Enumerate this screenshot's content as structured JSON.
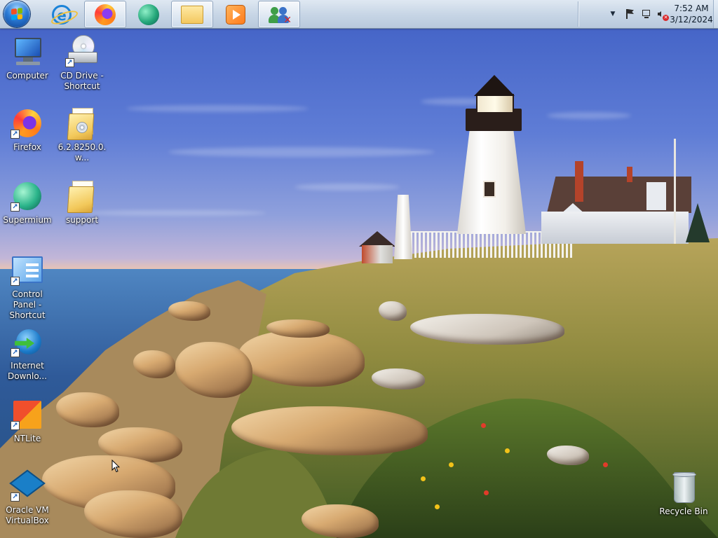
{
  "taskbar": {
    "start_button": {
      "icon": "windows-logo-icon",
      "label": "Start"
    },
    "pinned": [
      {
        "name": "internet-explorer",
        "icon": "internet-explorer-icon",
        "active": false
      },
      {
        "name": "firefox",
        "icon": "firefox-icon",
        "active": true
      },
      {
        "name": "supermium",
        "icon": "supermium-icon",
        "active": false
      },
      {
        "name": "file-explorer",
        "icon": "folder-icon",
        "active": true
      },
      {
        "name": "media-player",
        "icon": "media-player-icon",
        "active": false
      },
      {
        "name": "user-accounts",
        "icon": "users-icon",
        "active": true
      }
    ],
    "tray": {
      "time": "7:52 AM",
      "date": "3/12/2024",
      "icons": [
        "show-hidden-icons-chevron",
        "action-center-flag-icon",
        "network-icon",
        "volume-muted-icon"
      ]
    }
  },
  "desktop": {
    "icons": [
      {
        "label": "Computer",
        "icon": "computer-icon",
        "shortcut": false
      },
      {
        "label": "CD Drive - Shortcut",
        "icon": "cd-drive-icon",
        "shortcut": true
      },
      {
        "label": "Firefox",
        "icon": "firefox-icon",
        "shortcut": true
      },
      {
        "label": "6.2.8250.0.w...",
        "icon": "folder-icon",
        "shortcut": false
      },
      {
        "label": "Supermium",
        "icon": "supermium-icon",
        "shortcut": true
      },
      {
        "label": "support",
        "icon": "folder-icon",
        "shortcut": false
      },
      {
        "label": "Control Panel - Shortcut",
        "icon": "control-panel-icon",
        "shortcut": true
      },
      {
        "label": "Internet Downlo...",
        "icon": "internet-download-manager-icon",
        "shortcut": true
      },
      {
        "label": "NTLite",
        "icon": "ntlite-icon",
        "shortcut": true
      },
      {
        "label": "Oracle VM VirtualBox",
        "icon": "virtualbox-icon",
        "shortcut": true
      },
      {
        "label": "Recycle Bin",
        "icon": "recycle-bin-icon",
        "shortcut": false
      }
    ]
  },
  "wallpaper": {
    "subject": "lighthouse-coastal-wallpaper"
  },
  "colors": {
    "taskbar": "#c8d6e6",
    "sky": "#5f7dd6",
    "sea": "#2f5a99"
  }
}
